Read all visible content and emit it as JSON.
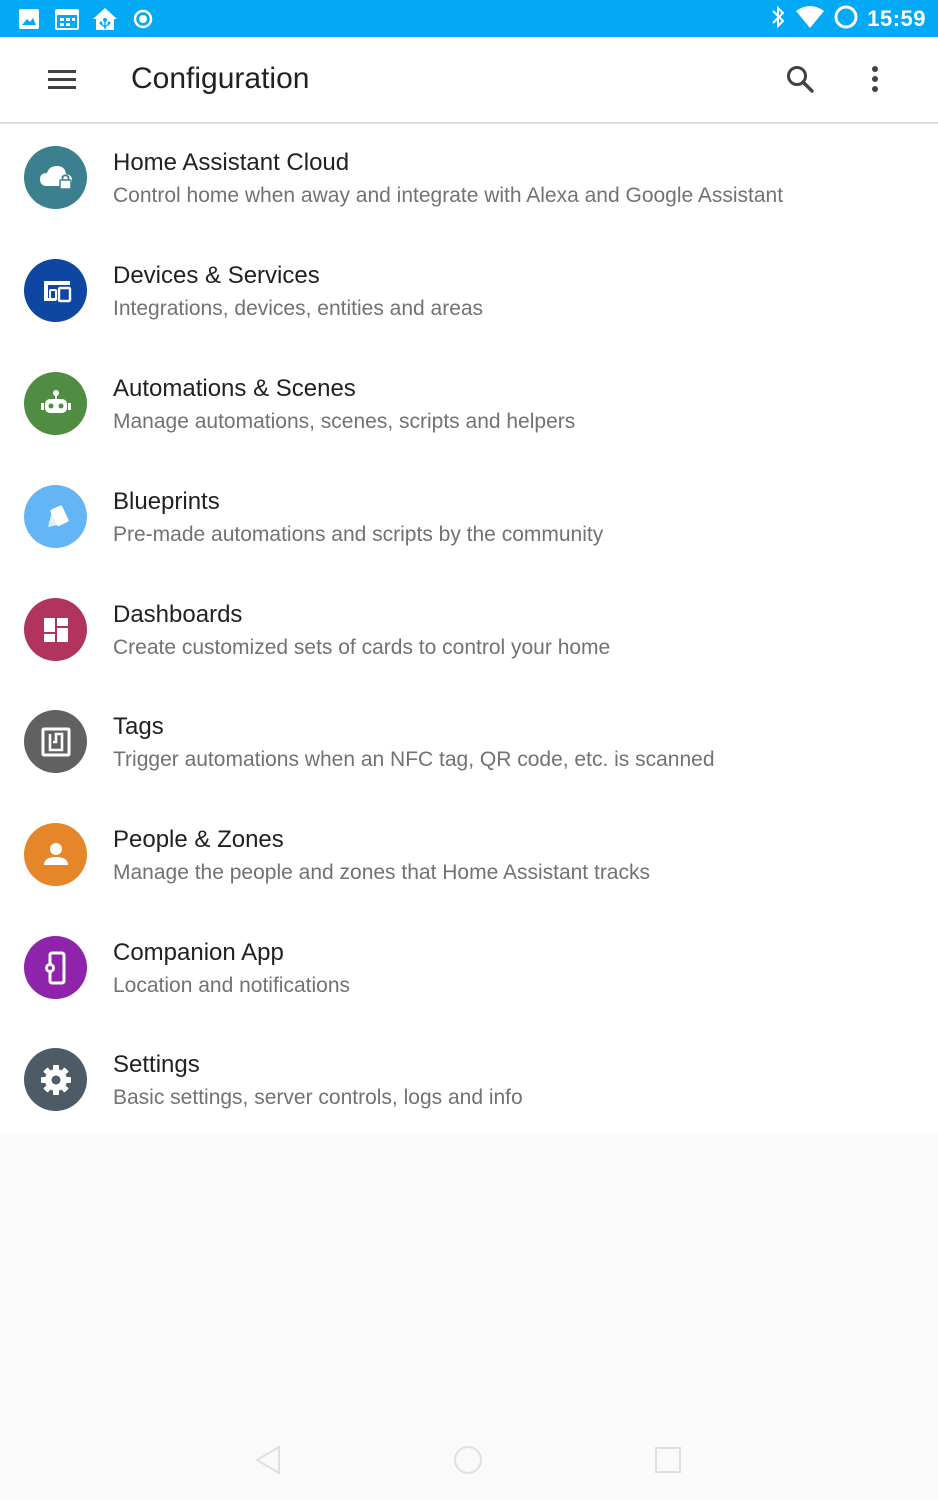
{
  "status_bar": {
    "time": "15:59",
    "left_icons": [
      "image-icon",
      "calendar-icon",
      "home-assistant-icon",
      "radio-button-icon"
    ],
    "right_icons": [
      "bluetooth-icon",
      "wifi-icon",
      "battery-ring-icon"
    ],
    "background": "#03a9f4"
  },
  "app_bar": {
    "title": "Configuration",
    "icons": [
      "menu-icon",
      "search-icon",
      "more-vert-icon"
    ]
  },
  "items": [
    {
      "title": "Home Assistant Cloud",
      "subtitle": "Control home when away and integrate with Alexa and Google Assistant",
      "icon": "cloud-lock-icon",
      "color": "#3b808e"
    },
    {
      "title": "Devices & Services",
      "subtitle": "Integrations, devices, entities and areas",
      "icon": "devices-icon",
      "color": "#0d47a1"
    },
    {
      "title": "Automations & Scenes",
      "subtitle": "Manage automations, scenes, scripts and helpers",
      "icon": "robot-icon",
      "color": "#518c43"
    },
    {
      "title": "Blueprints",
      "subtitle": "Pre-made automations and scripts by the community",
      "icon": "palette-swatch-icon",
      "color": "#64b5f6"
    },
    {
      "title": "Dashboards",
      "subtitle": "Create customized sets of cards to control your home",
      "icon": "dashboard-icon",
      "color": "#b1345c"
    },
    {
      "title": "Tags",
      "subtitle": "Trigger automations when an NFC tag, QR code, etc. is scanned",
      "icon": "nfc-icon",
      "color": "#616161"
    },
    {
      "title": "People & Zones",
      "subtitle": "Manage the people and zones that Home Assistant tracks",
      "icon": "account-icon",
      "color": "#e48629"
    },
    {
      "title": "Companion App",
      "subtitle": "Location and notifications",
      "icon": "cellphone-cog-icon",
      "color": "#8e24aa"
    },
    {
      "title": "Settings",
      "subtitle": "Basic settings, server controls, logs and info",
      "icon": "cog-icon",
      "color": "#4c5b66"
    }
  ],
  "nav_bar": {
    "icons": [
      "back-icon",
      "home-circle-icon",
      "recents-icon"
    ]
  }
}
